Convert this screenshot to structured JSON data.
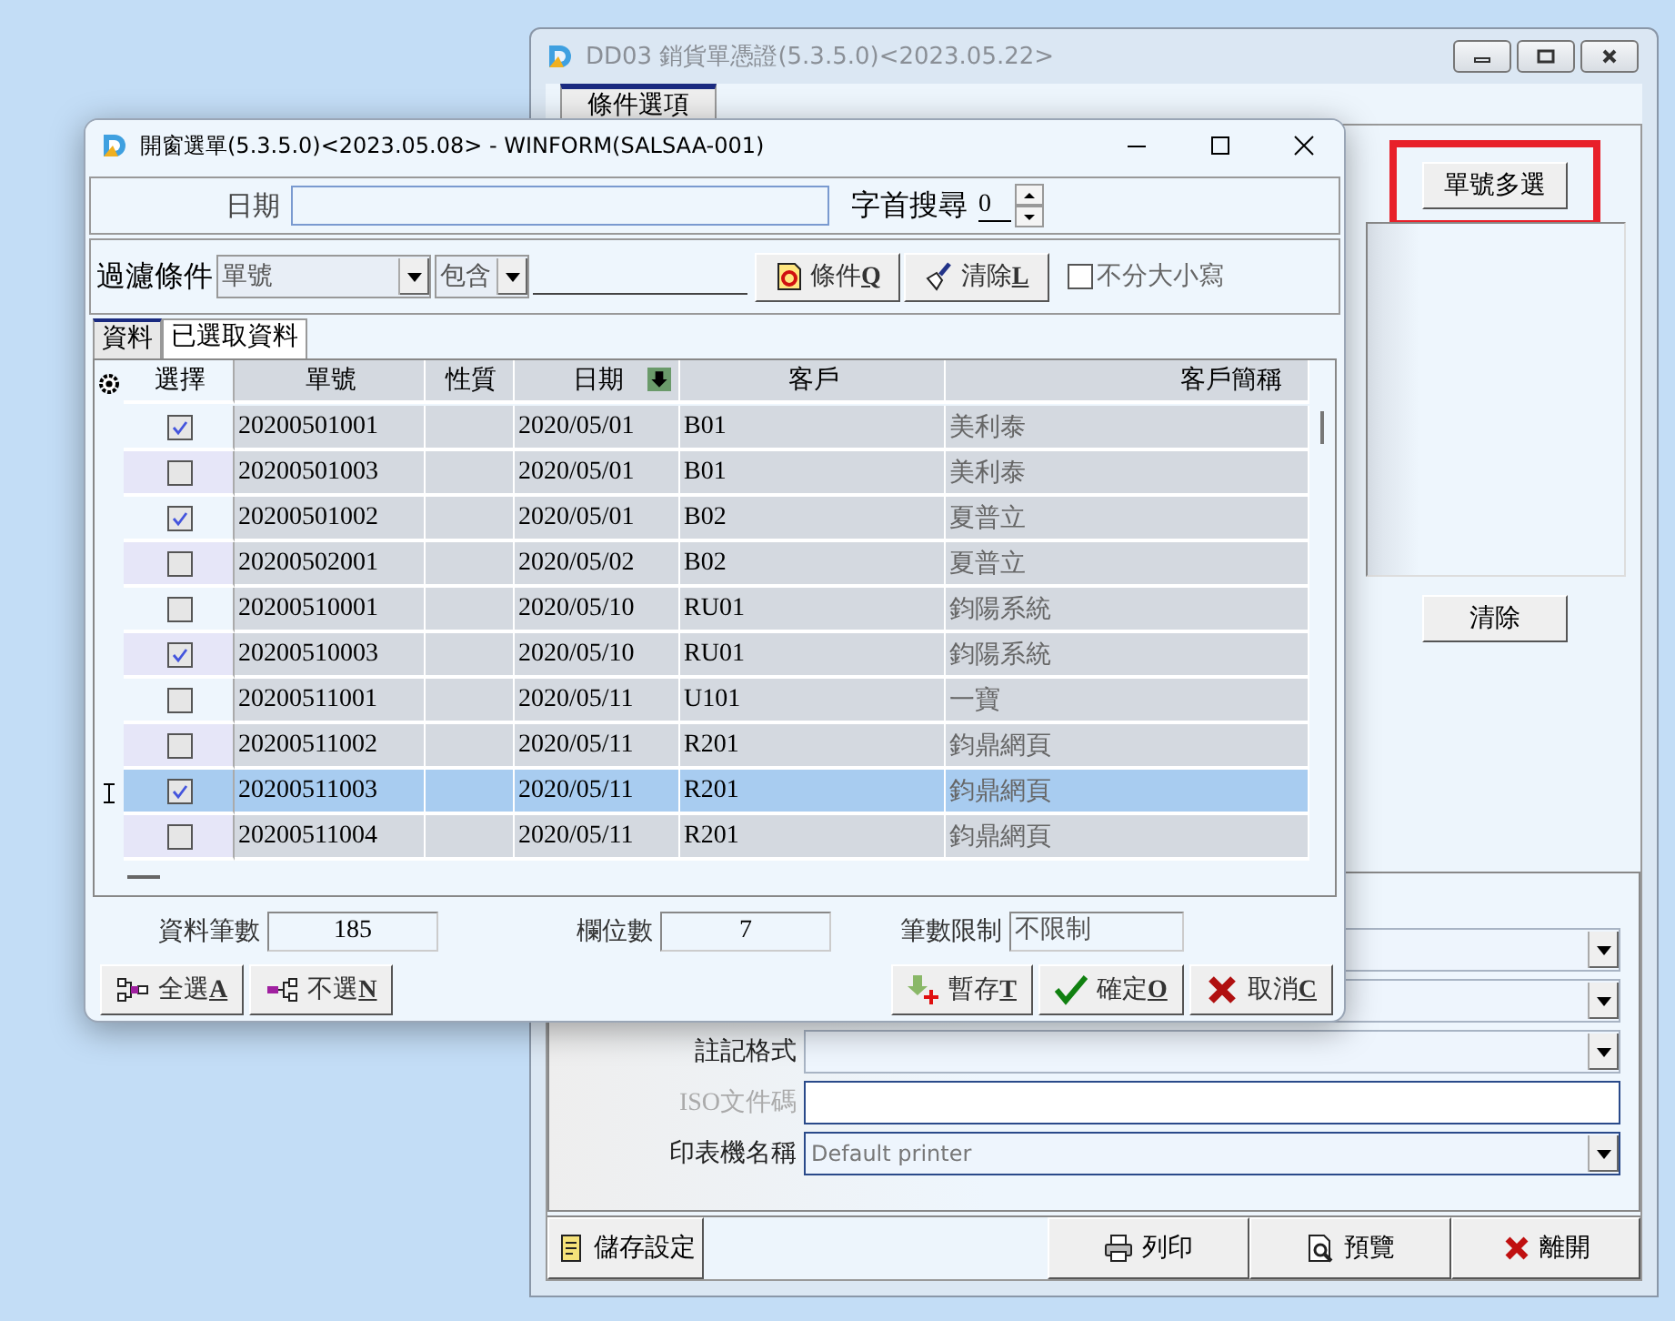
{
  "background_window": {
    "title": "DD03 銷貨單憑證(5.3.5.0)<2023.05.22>",
    "tab": {
      "label": "條件選項",
      "selected": true
    },
    "multi_select_button": {
      "label": "單號多選",
      "highlighted": true
    },
    "clear_button": "清除",
    "form": [
      {
        "kind": "dropdown",
        "disabled": false
      },
      {
        "kind": "dropdown",
        "disabled": false
      },
      {
        "kind": "dropdown",
        "label": "註記格式",
        "disabled": false
      },
      {
        "kind": "input",
        "label": "ISO文件碼",
        "disabled": true
      },
      {
        "kind": "dropdown",
        "label": "印表機名稱",
        "value": "Default printer",
        "disabled": false
      }
    ],
    "buttons": [
      {
        "kind": "save",
        "label": "儲存設定"
      },
      {
        "kind": "print",
        "label": "列印"
      },
      {
        "kind": "preview",
        "label": "預覽"
      },
      {
        "kind": "exit",
        "label": "離開"
      }
    ]
  },
  "dialog": {
    "title": "開窗選單(5.3.5.0)<2023.05.08> - WINFORM(SALSAA-001)",
    "date_label": "日期",
    "prefix_search_label": "字首搜尋",
    "prefix_search_value": "0",
    "filter_label": "過濾條件",
    "filter_field": "單號",
    "filter_operator": "包含",
    "filter_buttons": [
      {
        "kind": "condition",
        "label": "條件",
        "hotkey": "Q"
      },
      {
        "kind": "clear",
        "label": "清除",
        "hotkey": "L"
      }
    ],
    "case_insensitive": {
      "label": "不分大小寫",
      "checked": false
    },
    "tabs": [
      {
        "label": "資料",
        "selected": true
      },
      {
        "label": "已選取資料",
        "selected": false
      }
    ],
    "table": {
      "columns": [
        {
          "label": "選擇",
          "sorted": false
        },
        {
          "label": "單號",
          "sorted": false
        },
        {
          "label": "性質",
          "sorted": false
        },
        {
          "label": "日期",
          "sorted": true
        },
        {
          "label": "客戶",
          "sorted": false
        },
        {
          "label": "客戶簡稱",
          "sorted": false
        }
      ],
      "rows": [
        {
          "checked": true,
          "selected": false,
          "order_no": "20200501001",
          "date": "2020/05/01",
          "customer": "B01",
          "short_name": "美利泰"
        },
        {
          "checked": false,
          "selected": false,
          "order_no": "20200501003",
          "date": "2020/05/01",
          "customer": "B01",
          "short_name": "美利泰"
        },
        {
          "checked": true,
          "selected": false,
          "order_no": "20200501002",
          "date": "2020/05/01",
          "customer": "B02",
          "short_name": "夏普立"
        },
        {
          "checked": false,
          "selected": false,
          "order_no": "20200502001",
          "date": "2020/05/02",
          "customer": "B02",
          "short_name": "夏普立"
        },
        {
          "checked": false,
          "selected": false,
          "order_no": "20200510001",
          "date": "2020/05/10",
          "customer": "RU01",
          "short_name": "鈞陽系統"
        },
        {
          "checked": true,
          "selected": false,
          "order_no": "20200510003",
          "date": "2020/05/10",
          "customer": "RU01",
          "short_name": "鈞陽系統"
        },
        {
          "checked": false,
          "selected": false,
          "order_no": "20200511001",
          "date": "2020/05/11",
          "customer": "U101",
          "short_name": "一寶"
        },
        {
          "checked": false,
          "selected": false,
          "order_no": "20200511002",
          "date": "2020/05/11",
          "customer": "R201",
          "short_name": "鈞鼎網頁"
        },
        {
          "checked": true,
          "selected": true,
          "order_no": "20200511003",
          "date": "2020/05/11",
          "customer": "R201",
          "short_name": "鈞鼎網頁"
        },
        {
          "checked": false,
          "selected": false,
          "order_no": "20200511004",
          "date": "2020/05/11",
          "customer": "R201",
          "short_name": "鈞鼎網頁"
        }
      ]
    },
    "stats": [
      {
        "label": "資料筆數",
        "value": "185"
      },
      {
        "label": "欄位數",
        "value": "7"
      },
      {
        "label": "筆數限制",
        "value": "不限制"
      }
    ],
    "left_buttons": [
      {
        "kind": "select_all",
        "label": "全選",
        "hotkey": "A"
      },
      {
        "kind": "select_none",
        "label": "不選",
        "hotkey": "N"
      }
    ],
    "right_buttons": [
      {
        "kind": "save_temp",
        "label": "暫存",
        "hotkey": "T"
      },
      {
        "kind": "ok",
        "label": "確定",
        "hotkey": "O"
      },
      {
        "kind": "cancel",
        "label": "取消",
        "hotkey": "C"
      }
    ]
  }
}
